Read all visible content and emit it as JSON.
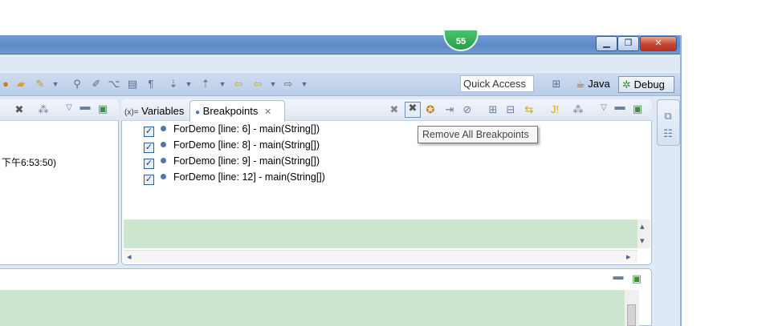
{
  "window": {
    "badge": "55",
    "minimize": "▁",
    "restore": "❐",
    "close": "✕"
  },
  "toolbar": {
    "quick_access": "Quick Access",
    "perspective_java": "Java",
    "perspective_debug": "Debug"
  },
  "left_panel": {
    "session_time": "下午6:53:50)"
  },
  "views": {
    "variables_tab": "Variables",
    "variables_prefix": "(x)=",
    "breakpoints_tab": "Breakpoints"
  },
  "breakpoints": [
    {
      "label": "ForDemo [line: 6] - main(String[])",
      "checked": true
    },
    {
      "label": "ForDemo [line: 8] - main(String[])",
      "checked": true
    },
    {
      "label": "ForDemo [line: 9] - main(String[])",
      "checked": true
    },
    {
      "label": "ForDemo [line: 12] - main(String[])",
      "checked": true
    }
  ],
  "tooltip": "Remove All Breakpoints",
  "colors": {
    "accent": "#6f9bd1",
    "detail_bg": "#cde6cf",
    "badge": "#2b9c49"
  }
}
